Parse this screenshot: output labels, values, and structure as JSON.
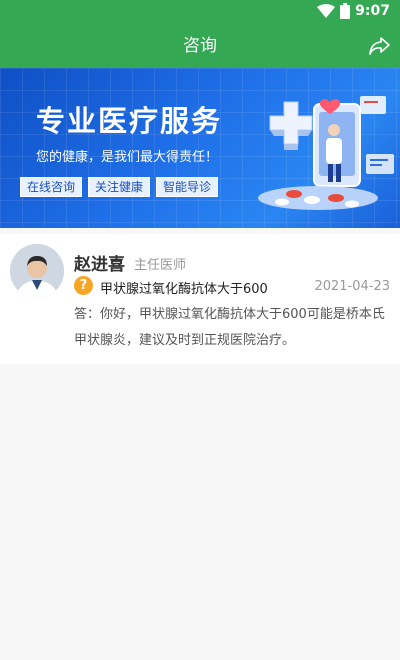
{
  "status_bar": {
    "time": "9:07"
  },
  "app_bar": {
    "title": "咨询"
  },
  "banner": {
    "headline": "专业医疗服务",
    "slogan": "您的健康，是我们最大得责任！",
    "tags": [
      "在线咨询",
      "关注健康",
      "智能导诊"
    ]
  },
  "consultation": {
    "doctor_name": "赵进喜",
    "doctor_title": "主任医师",
    "question_badge": "?",
    "question": "甲状腺过氧化酶抗体大于600",
    "date": "2021-04-23",
    "answer": "答：你好，甲状腺过氧化酶抗体大于600可能是桥本氏甲状腺炎，建议及时到正规医院治疗。"
  },
  "colors": {
    "primary_green": "#34a853",
    "banner_blue": "#1f6fe8",
    "question_badge": "#f5a623"
  },
  "icons": [
    "wifi-icon",
    "battery-icon",
    "share-icon",
    "question-icon",
    "doctor-avatar"
  ]
}
